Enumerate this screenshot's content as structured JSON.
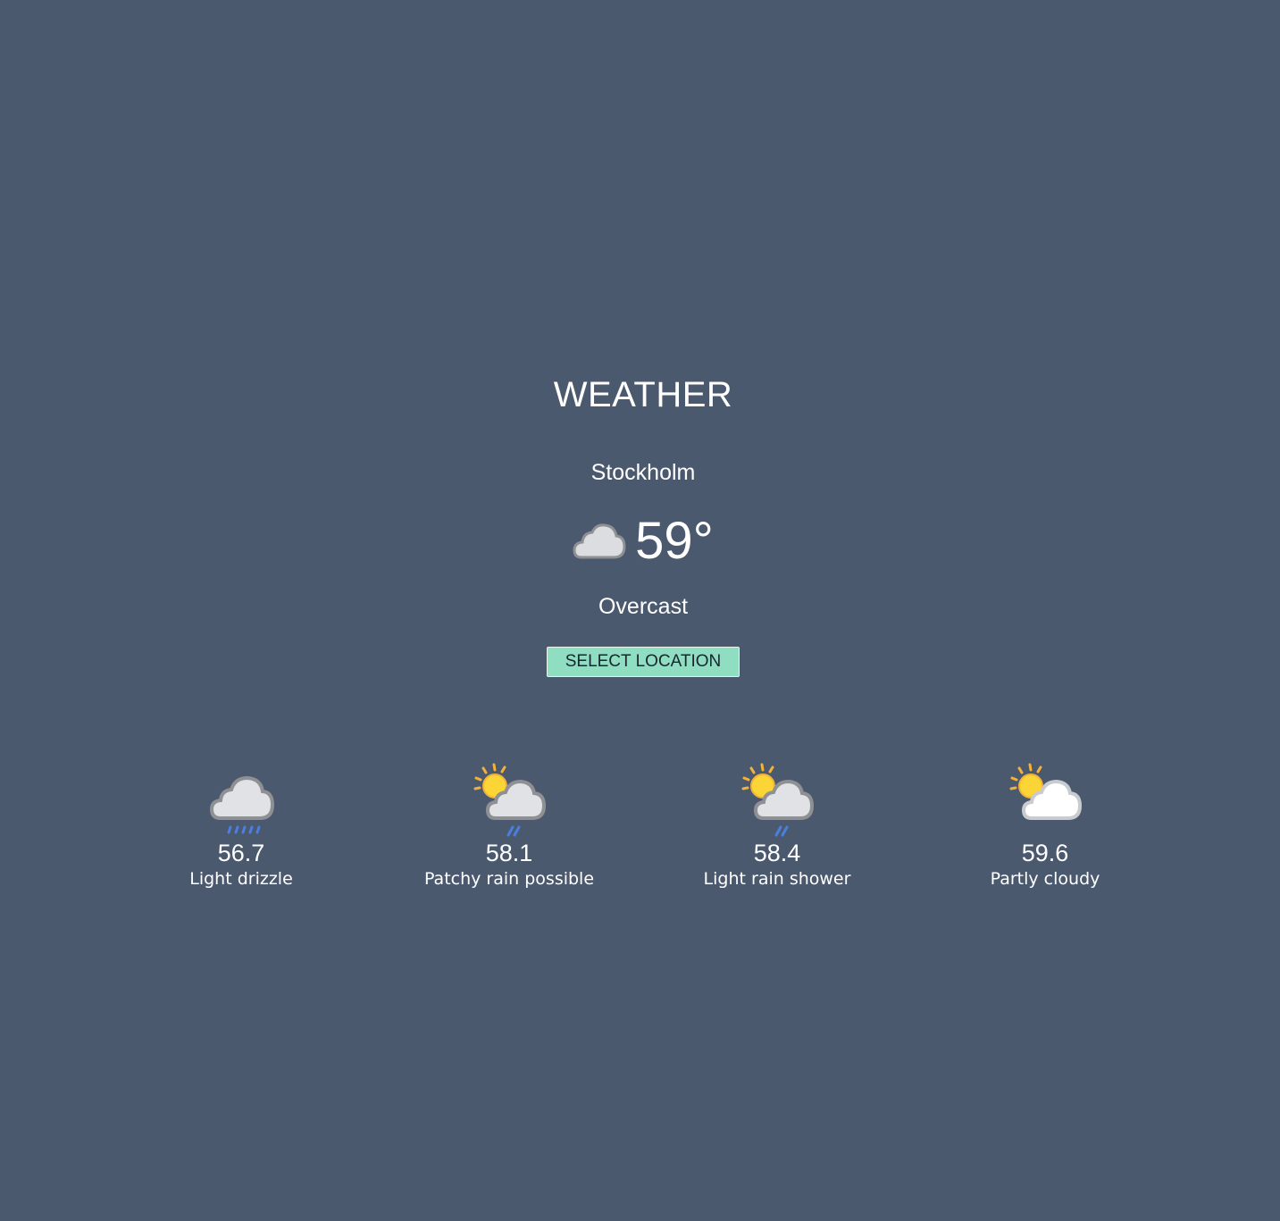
{
  "app": {
    "title": "WEATHER",
    "colors": {
      "background": "#4b596f",
      "button": "#8fdec2",
      "text": "#ffffff"
    }
  },
  "current": {
    "location": "Stockholm",
    "temperature": "59°",
    "condition": "Overcast",
    "icon": "cloud-icon"
  },
  "actions": {
    "select_location_label": "SELECT LOCATION"
  },
  "forecast": [
    {
      "temp": "56.7",
      "description": "Light drizzle",
      "icon": "cloud-drizzle-icon"
    },
    {
      "temp": "58.1",
      "description": "Patchy rain possible",
      "icon": "sun-cloud-rain-icon"
    },
    {
      "temp": "58.4",
      "description": "Light rain shower",
      "icon": "sun-cloud-rain-icon"
    },
    {
      "temp": "59.6",
      "description": "Partly cloudy",
      "icon": "sun-cloud-icon"
    }
  ]
}
